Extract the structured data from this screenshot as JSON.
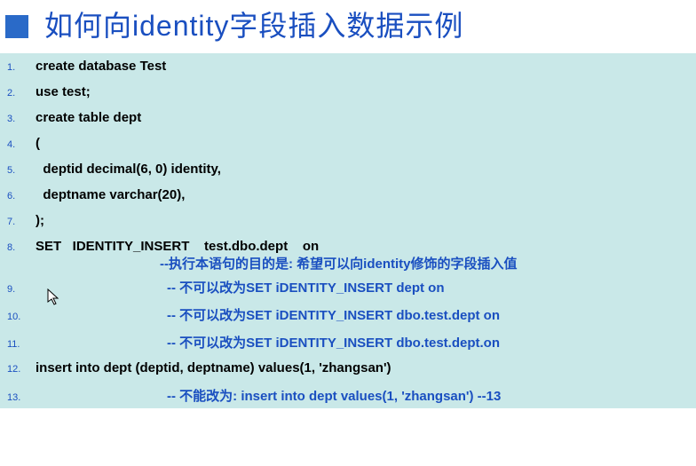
{
  "title": "如何向identity字段插入数据示例",
  "lines": {
    "l1": {
      "num": "1.",
      "text": "create database Test"
    },
    "l2": {
      "num": "2.",
      "text": "use test;"
    },
    "l3": {
      "num": "3.",
      "text": "create table dept"
    },
    "l4": {
      "num": "4.",
      "text": "("
    },
    "l5": {
      "num": "5.",
      "text": "  deptid decimal(6, 0) identity,"
    },
    "l6": {
      "num": "6.",
      "text": "  deptname varchar(20),"
    },
    "l7": {
      "num": "7.",
      "text": ");"
    },
    "l8": {
      "num": "8.",
      "text": "SET   IDENTITY_INSERT    test.dbo.dept    on"
    },
    "l12": {
      "num": "12.",
      "text": "insert into dept (deptid, deptname) values(1, 'zhangsan')"
    }
  },
  "comments": {
    "c8": "--执行本语句的目的是:  希望可以向identity修饰的字段插入值",
    "c9": {
      "num": "9.",
      "text": "--  不可以改为SET iDENTITY_INSERT dept on"
    },
    "c10": {
      "num": "10.",
      "text": "--  不可以改为SET iDENTITY_INSERT dbo.test.dept on"
    },
    "c11": {
      "num": "11.",
      "text": "--  不可以改为SET iDENTITY_INSERT dbo.test.dept.on"
    },
    "c13": {
      "num": "13.",
      "text": "--  不能改为: insert into dept values(1, 'zhangsan')  --13"
    }
  }
}
